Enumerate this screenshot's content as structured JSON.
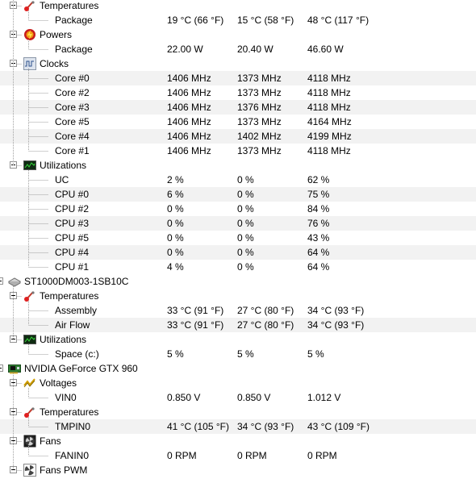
{
  "rows": [
    {
      "level": 1,
      "label": "Temperatures",
      "icon": "thermometer-icon",
      "name": "group-temperatures"
    },
    {
      "level": 2,
      "label": "Package",
      "c1": "19 °C  (66 °F)",
      "c2": "15 °C  (58 °F)",
      "c3": "48 °C  (117 °F)",
      "name": "sensor-row"
    },
    {
      "level": 1,
      "label": "Powers",
      "icon": "power-icon",
      "name": "group-powers"
    },
    {
      "level": 2,
      "label": "Package",
      "c1": "22.00 W",
      "c2": "20.40 W",
      "c3": "46.60 W",
      "name": "sensor-row"
    },
    {
      "level": 1,
      "label": "Clocks",
      "icon": "clock-icon",
      "name": "group-clocks"
    },
    {
      "level": 2,
      "label": "Core #0",
      "c1": "1406 MHz",
      "c2": "1373 MHz",
      "c3": "4118 MHz",
      "alt": true,
      "name": "sensor-row"
    },
    {
      "level": 2,
      "label": "Core #2",
      "c1": "1406 MHz",
      "c2": "1373 MHz",
      "c3": "4118 MHz",
      "name": "sensor-row"
    },
    {
      "level": 2,
      "label": "Core #3",
      "c1": "1406 MHz",
      "c2": "1376 MHz",
      "c3": "4118 MHz",
      "alt": true,
      "name": "sensor-row"
    },
    {
      "level": 2,
      "label": "Core #5",
      "c1": "1406 MHz",
      "c2": "1373 MHz",
      "c3": "4164 MHz",
      "name": "sensor-row"
    },
    {
      "level": 2,
      "label": "Core #4",
      "c1": "1406 MHz",
      "c2": "1402 MHz",
      "c3": "4199 MHz",
      "alt": true,
      "name": "sensor-row"
    },
    {
      "level": 2,
      "label": "Core #1",
      "c1": "1406 MHz",
      "c2": "1373 MHz",
      "c3": "4118 MHz",
      "name": "sensor-row"
    },
    {
      "level": 1,
      "label": "Utilizations",
      "icon": "utilization-icon",
      "name": "group-utilizations"
    },
    {
      "level": 2,
      "label": "UC",
      "c1": "2 %",
      "c2": "0 %",
      "c3": "62 %",
      "name": "sensor-row"
    },
    {
      "level": 2,
      "label": "CPU #0",
      "c1": "6 %",
      "c2": "0 %",
      "c3": "75 %",
      "alt": true,
      "name": "sensor-row"
    },
    {
      "level": 2,
      "label": "CPU #2",
      "c1": "0 %",
      "c2": "0 %",
      "c3": "84 %",
      "name": "sensor-row"
    },
    {
      "level": 2,
      "label": "CPU #3",
      "c1": "0 %",
      "c2": "0 %",
      "c3": "76 %",
      "alt": true,
      "name": "sensor-row"
    },
    {
      "level": 2,
      "label": "CPU #5",
      "c1": "0 %",
      "c2": "0 %",
      "c3": "43 %",
      "name": "sensor-row"
    },
    {
      "level": 2,
      "label": "CPU #4",
      "c1": "0 %",
      "c2": "0 %",
      "c3": "64 %",
      "alt": true,
      "name": "sensor-row"
    },
    {
      "level": 2,
      "label": "CPU #1",
      "c1": "4 %",
      "c2": "0 %",
      "c3": "64 %",
      "name": "sensor-row"
    },
    {
      "level": 0,
      "label": "ST1000DM003-1SB10C",
      "icon": "hdd-icon",
      "name": "device-hdd"
    },
    {
      "level": 1,
      "label": "Temperatures",
      "icon": "thermometer-icon",
      "name": "group-temperatures"
    },
    {
      "level": 2,
      "label": "Assembly",
      "c1": "33 °C  (91 °F)",
      "c2": "27 °C  (80 °F)",
      "c3": "34 °C  (93 °F)",
      "name": "sensor-row"
    },
    {
      "level": 2,
      "label": "Air Flow",
      "c1": "33 °C  (91 °F)",
      "c2": "27 °C  (80 °F)",
      "c3": "34 °C  (93 °F)",
      "alt": true,
      "name": "sensor-row"
    },
    {
      "level": 1,
      "label": "Utilizations",
      "icon": "utilization-icon",
      "name": "group-utilizations"
    },
    {
      "level": 2,
      "label": "Space (c:)",
      "c1": "5 %",
      "c2": "5 %",
      "c3": "5 %",
      "name": "sensor-row"
    },
    {
      "level": 0,
      "label": "NVIDIA GeForce GTX 960",
      "icon": "gpu-icon",
      "name": "device-gpu"
    },
    {
      "level": 1,
      "label": "Voltages",
      "icon": "voltage-icon",
      "name": "group-voltages"
    },
    {
      "level": 2,
      "label": "VIN0",
      "c1": "0.850 V",
      "c2": "0.850 V",
      "c3": "1.012 V",
      "name": "sensor-row"
    },
    {
      "level": 1,
      "label": "Temperatures",
      "icon": "thermometer-icon",
      "name": "group-temperatures"
    },
    {
      "level": 2,
      "label": "TMPIN0",
      "c1": "41 °C  (105 °F)",
      "c2": "34 °C  (93 °F)",
      "c3": "43 °C  (109 °F)",
      "alt": true,
      "name": "sensor-row"
    },
    {
      "level": 1,
      "label": "Fans",
      "icon": "fan-icon",
      "name": "group-fans"
    },
    {
      "level": 2,
      "label": "FANIN0",
      "c1": "0 RPM",
      "c2": "0 RPM",
      "c3": "0 RPM",
      "name": "sensor-row"
    },
    {
      "level": 1,
      "label": "Fans PWM",
      "icon": "fan-pwm-icon",
      "name": "group-fans-pwm"
    }
  ]
}
